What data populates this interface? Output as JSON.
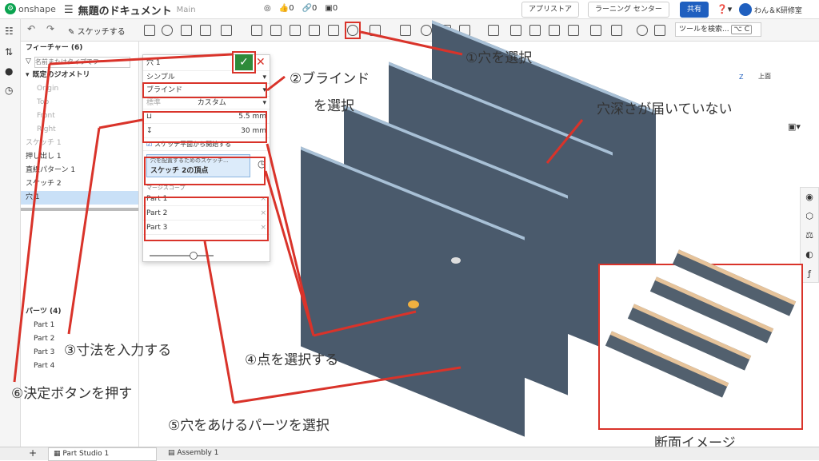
{
  "app": {
    "logo": "onshape",
    "title": "無題のドキュメント",
    "branch": "Main",
    "counts": [
      "0",
      "0",
      "0"
    ]
  },
  "header": {
    "buttons": [
      "アプリストア",
      "ラーニング センター",
      "共有"
    ],
    "user": "わん＆K研修室"
  },
  "toolbar": {
    "sketch": "スケッチする",
    "search": "ツールを検索...",
    "shortcut": "⌥ C"
  },
  "features": {
    "title": "フィーチャー (6)",
    "search_placeholder": "名前またはタイプでフ",
    "default_geo": "既定のジオメトリ",
    "planes": [
      "Origin",
      "Top",
      "Front",
      "Right"
    ],
    "items": [
      "スケッチ 1",
      "押し出し 1",
      "直線パターン 1",
      "スケッチ 2",
      "穴 1"
    ]
  },
  "parts": {
    "title": "パーツ (4)",
    "items": [
      "Part 1",
      "Part 2",
      "Part 3",
      "Part 4"
    ]
  },
  "dialog": {
    "title": "穴 1",
    "style": "シンプル",
    "end": "ブラインド",
    "std_label": "標準",
    "std": "カスタム",
    "dia": "5.5 mm",
    "depth": "30 mm",
    "start_from_sketch": "スケッチ平面から開始する",
    "sketch_label": "穴を配置するためのスケッチ...",
    "sketch_value": "スケッチ 2の頂点",
    "scope_label": "マージスコープ",
    "scope": [
      "Part 1",
      "Part 2",
      "Part 3"
    ]
  },
  "tabs": [
    "Part Studio 1",
    "Assembly 1"
  ],
  "annotations": {
    "a1": "①穴を選択",
    "a2a": "②ブラインド",
    "a2b": "を選択",
    "a3": "③寸法を入力する",
    "a4": "④点を選択する",
    "a5": "⑤穴をあけるパーツを選択",
    "a6": "⑥決定ボタンを押す",
    "depth": "穴深さが届いていない",
    "section": "断面イメージ"
  },
  "viewcube": {
    "label": "上面",
    "axis_z": "Z"
  },
  "colors": {
    "accent": "#d9332a",
    "plate": "#4a5a6c",
    "confirm": "#2e8b3a"
  }
}
